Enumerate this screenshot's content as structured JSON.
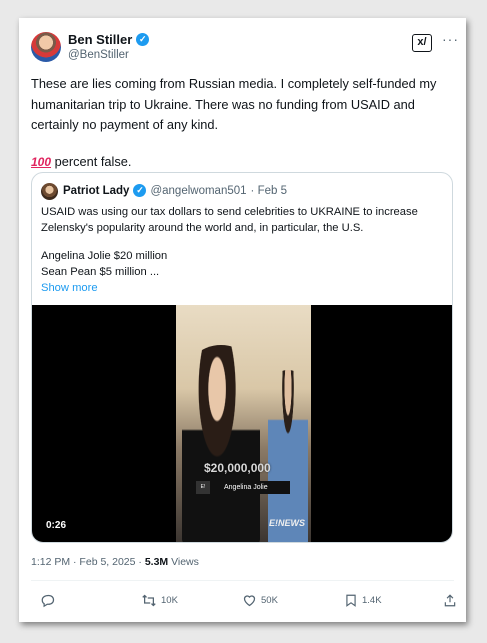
{
  "tweet": {
    "author_name": "Ben Stiller",
    "author_handle": "@BenStiller",
    "grok_label": "x/",
    "more_label": "···",
    "text_line1": "These are lies coming from Russian media. I completely self-funded my humanitarian trip to Ukraine. There was no funding from USAID and certainly no payment of any kind.",
    "text_emoji": "100",
    "text_line2": " percent false.",
    "timestamp": "1:12 PM · Feb 5, 2025 · ",
    "views_count": "5.3M",
    "views_label": " Views"
  },
  "quote": {
    "author_name": "Patriot Lady",
    "author_handle": "@angelwoman501",
    "date": "· Feb 5",
    "text_para1": "USAID was using our tax dollars to send celebrities to UKRAINE to increase Zelensky's popularity around the world and, in particular, the U.S.",
    "text_line2": "Angelina Jolie $20 million",
    "text_line3": "Sean Pean $5 million ...",
    "show_more": "Show more",
    "video": {
      "overlay_amount": "$20,000,000",
      "lower_third_logo": "E!",
      "lower_third_name": "Angelina Jolie",
      "watermark": "E!NEWS",
      "duration": "0:26"
    }
  },
  "actions": {
    "replies": "",
    "reposts": "10K",
    "likes": "50K",
    "bookmarks": "1.4K"
  },
  "colors": {
    "accent": "#1d9bf0",
    "text": "#0f1419",
    "muted": "#536471"
  }
}
